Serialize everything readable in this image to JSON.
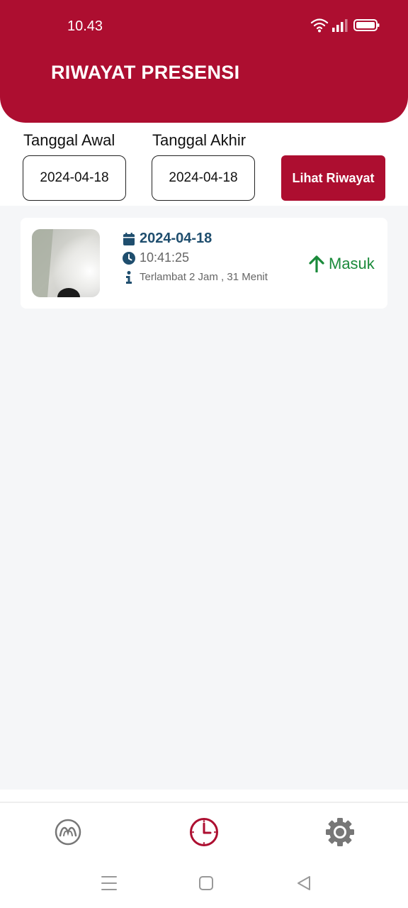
{
  "status_bar": {
    "time": "10.43"
  },
  "header": {
    "title": "RIWAYAT PRESENSI"
  },
  "filter": {
    "start_label": "Tanggal Awal",
    "start_value": "2024-04-18",
    "end_label": "Tanggal Akhir",
    "end_value": "2024-04-18",
    "button_label": "Lihat Riwayat"
  },
  "records": [
    {
      "date": "2024-04-18",
      "time": "10:41:25",
      "note": "Terlambat 2 Jam , 31 Menit",
      "status": "Masuk"
    }
  ],
  "icons": {
    "calendar": "calendar-icon",
    "clock": "clock-icon",
    "info": "info-icon",
    "arrow": "arrow-up-icon",
    "nav_home": "dashboard-icon",
    "nav_history": "clock-icon",
    "nav_settings": "gear-icon"
  },
  "colors": {
    "brand": "#ad0e30",
    "date_text": "#1f4e6e",
    "status_in": "#1a8a3a"
  }
}
